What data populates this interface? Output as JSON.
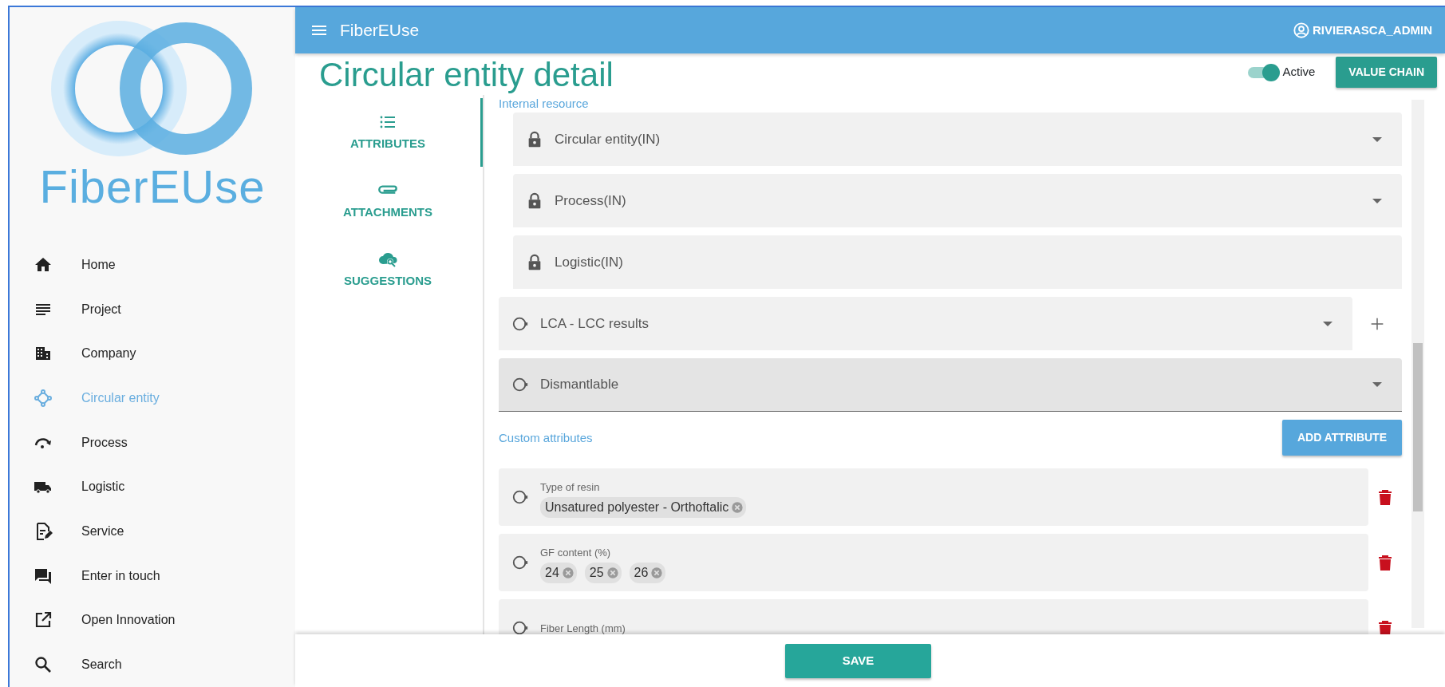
{
  "sidebar": {
    "logo_text": "FiberEUse",
    "items": [
      {
        "label": "Home",
        "selected": false
      },
      {
        "label": "Project",
        "selected": false
      },
      {
        "label": "Company",
        "selected": false
      },
      {
        "label": "Circular entity",
        "selected": true
      },
      {
        "label": "Process",
        "selected": false
      },
      {
        "label": "Logistic",
        "selected": false
      },
      {
        "label": "Service",
        "selected": false
      },
      {
        "label": "Enter in touch",
        "selected": false
      },
      {
        "label": "Open Innovation",
        "selected": false
      },
      {
        "label": "Search",
        "selected": false
      }
    ]
  },
  "header": {
    "title": "FiberEUse",
    "user": "RIVIERASCA_ADMIN"
  },
  "page_title": "Circular entity detail",
  "active_toggle": {
    "label": "Active",
    "on": true
  },
  "value_chain_button": "VALUE CHAIN",
  "tabs": [
    {
      "label": "ATTRIBUTES",
      "selected": true
    },
    {
      "label": "ATTACHMENTS",
      "selected": false
    },
    {
      "label": "SUGGESTIONS",
      "selected": false
    }
  ],
  "internal_resource": {
    "label": "Internal resource",
    "fields": [
      {
        "label": "Circular entity(IN)",
        "kind": "locked",
        "dropdown": true,
        "add": false,
        "focused": false
      },
      {
        "label": "Process(IN)",
        "kind": "locked",
        "dropdown": true,
        "add": false,
        "focused": false
      },
      {
        "label": "Logistic(IN)",
        "kind": "locked",
        "dropdown": false,
        "add": false,
        "focused": false
      },
      {
        "label": "LCA - LCC results",
        "kind": "select",
        "dropdown": true,
        "add": true,
        "focused": false
      },
      {
        "label": "Dismantlable",
        "kind": "select",
        "dropdown": true,
        "add": false,
        "focused": true
      }
    ]
  },
  "custom_attributes": {
    "label": "Custom attributes",
    "add_button": "ADD ATTRIBUTE",
    "items": [
      {
        "label": "Type of resin",
        "values": [
          "Unsatured polyester - Orthoftalic"
        ]
      },
      {
        "label": "GF content (%)",
        "values": [
          "24",
          "25",
          "26"
        ]
      },
      {
        "label": "Fiber Length (mm)"
      }
    ]
  },
  "save_button": "SAVE"
}
